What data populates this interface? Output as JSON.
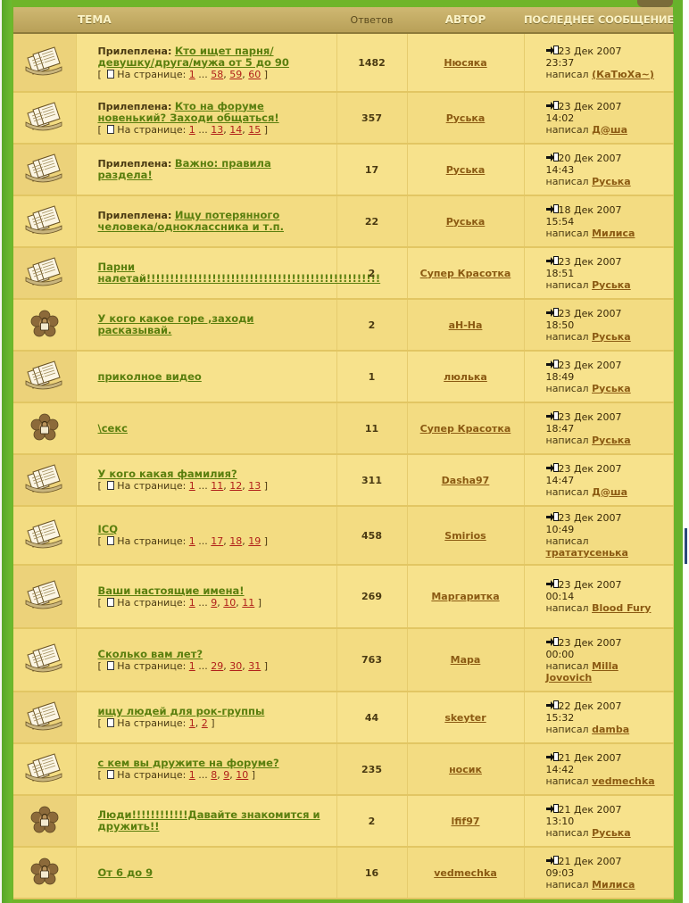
{
  "header": {
    "topic": "ТЕМА",
    "replies": "Ответов",
    "author": "АВТОР",
    "last_post": "ПОСЛЕДНЕЕ СООБЩЕНИЕ"
  },
  "labels": {
    "sticky": "Прилеплена:",
    "to_page": "На странице:",
    "wrote": "написал",
    "ellipsis": "..."
  },
  "colors": {
    "topic_link": "#5a7f0e",
    "author_link": "#8b5a12",
    "page_link": "#b0201a",
    "row_bg": "#f7e28c",
    "header_bg": "#c4ad63"
  },
  "topics": [
    {
      "icon": "topic-book-icon",
      "sticky": true,
      "title": "Кто ищет парня/девушку/друга/мужа от 5 до 90",
      "pages": [
        "1",
        "58",
        "59",
        "60"
      ],
      "replies": "1482",
      "author": "Нюсяка",
      "last_date": "23 Дек 2007 23:37",
      "last_author": "(КаТюХа~)"
    },
    {
      "icon": "topic-book-icon",
      "sticky": true,
      "title": "Кто на форуме новенький? Заходи общаться!",
      "pages": [
        "1",
        "13",
        "14",
        "15"
      ],
      "replies": "357",
      "author": "Руська",
      "last_date": "23 Дек 2007 14:02",
      "last_author": "Д@ша"
    },
    {
      "icon": "topic-book-icon",
      "sticky": true,
      "title": "Важно: правила раздела!",
      "pages": [],
      "replies": "17",
      "author": "Руська",
      "last_date": "20 Дек 2007 14:43",
      "last_author": "Руська"
    },
    {
      "icon": "topic-book-icon",
      "sticky": true,
      "title": "Ищу потерянного человека/одноклассника и т.п.",
      "pages": [],
      "replies": "22",
      "author": "Руська",
      "last_date": "18 Дек 2007 15:54",
      "last_author": "Милиса"
    },
    {
      "icon": "topic-book-icon",
      "sticky": false,
      "title": "Парни налетай!!!!!!!!!!!!!!!!!!!!!!!!!!!!!!!!!!!!!!!!!!!!!!!!!!",
      "pages": [],
      "replies": "2",
      "author": "Супер Красотка",
      "last_date": "23 Дек 2007 18:51",
      "last_author": "Руська"
    },
    {
      "icon": "locked-topic-icon",
      "sticky": false,
      "title": "У кого какое горе ,заходи расказывай.",
      "pages": [],
      "replies": "2",
      "author": "aH-Ha",
      "last_date": "23 Дек 2007 18:50",
      "last_author": "Руська"
    },
    {
      "icon": "topic-book-icon",
      "sticky": false,
      "title": "приколное видео",
      "pages": [],
      "replies": "1",
      "author": "люлька",
      "last_date": "23 Дек 2007 18:49",
      "last_author": "Руська"
    },
    {
      "icon": "locked-topic-icon",
      "sticky": false,
      "title": "\\секс",
      "pages": [],
      "replies": "11",
      "author": "Супер Красотка",
      "last_date": "23 Дек 2007 18:47",
      "last_author": "Руська"
    },
    {
      "icon": "topic-book-icon",
      "sticky": false,
      "title": "У кого какая фамилия?",
      "pages": [
        "1",
        "11",
        "12",
        "13"
      ],
      "replies": "311",
      "author": "Dasha97",
      "last_date": "23 Дек 2007 14:47",
      "last_author": "Д@ша"
    },
    {
      "icon": "topic-book-icon",
      "sticky": false,
      "title": "ICQ",
      "pages": [
        "1",
        "17",
        "18",
        "19"
      ],
      "replies": "458",
      "author": "Smirios",
      "last_date": "23 Дек 2007 10:49",
      "last_author": "трататусенька"
    },
    {
      "icon": "topic-book-icon",
      "sticky": false,
      "title": "Ваши настоящие имена!",
      "pages": [
        "1",
        "9",
        "10",
        "11"
      ],
      "replies": "269",
      "author": "Маргаритка",
      "last_date": "23 Дек 2007 00:14",
      "last_author": "Blood Fury"
    },
    {
      "icon": "topic-book-icon",
      "sticky": false,
      "title": "Сколько вам лет?",
      "pages": [
        "1",
        "29",
        "30",
        "31"
      ],
      "replies": "763",
      "author": "Мара",
      "last_date": "23 Дек 2007 00:00",
      "last_author": "Milla Jovovich"
    },
    {
      "icon": "topic-book-icon",
      "sticky": false,
      "title": "ищу людей для рок-группы",
      "pages": [
        "1",
        "2"
      ],
      "replies": "44",
      "author": "skeyter",
      "last_date": "22 Дек 2007 15:32",
      "last_author": "damba"
    },
    {
      "icon": "topic-book-icon",
      "sticky": false,
      "title": "с кем вы дружите на форуме?",
      "pages": [
        "1",
        "8",
        "9",
        "10"
      ],
      "replies": "235",
      "author": "носик",
      "last_date": "21 Дек 2007 14:42",
      "last_author": "vedmechka"
    },
    {
      "icon": "locked-topic-icon",
      "sticky": false,
      "title": "Люди!!!!!!!!!!!!Давайте знакомится и дружить!!",
      "pages": [],
      "replies": "2",
      "author": "lfif97",
      "last_date": "21 Дек 2007 13:10",
      "last_author": "Руська"
    },
    {
      "icon": "locked-topic-icon",
      "sticky": false,
      "title": "От 6 до 9",
      "pages": [],
      "replies": "16",
      "author": "vedmechka",
      "last_date": "21 Дек 2007 09:03",
      "last_author": "Милиса"
    }
  ]
}
